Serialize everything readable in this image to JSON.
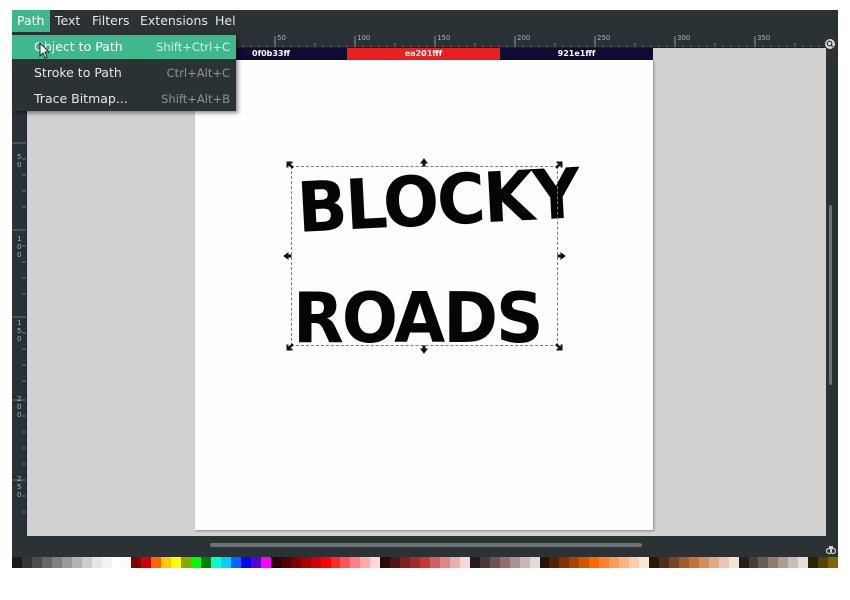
{
  "menubar": {
    "items": [
      {
        "label": "Path"
      },
      {
        "label": "Text"
      },
      {
        "label": "Filters"
      },
      {
        "label": "Extensions"
      },
      {
        "label": "Help"
      }
    ]
  },
  "path_menu": {
    "items": [
      {
        "label": "Object to Path",
        "shortcut": "Shift+Ctrl+C"
      },
      {
        "label": "Stroke to Path",
        "shortcut": "Ctrl+Alt+C"
      },
      {
        "label": "Trace Bitmap...",
        "shortcut": "Shift+Alt+B"
      }
    ]
  },
  "ruler": {
    "h_labels": [
      "50",
      "100",
      "150",
      "200",
      "250",
      "300",
      "350"
    ],
    "v_labels": [
      "5\n0",
      "1\n0\n0",
      "1\n5\n0",
      "2\n0\n0",
      "2\n5\n0"
    ]
  },
  "swatch_bar": [
    {
      "label": "0f0b33ff",
      "color": "#0f0b33"
    },
    {
      "label": "ea201fff",
      "color": "#ea201f"
    },
    {
      "label": "921e1fff",
      "color": "#0f0b33"
    }
  ],
  "artwork": {
    "line1": "BLOCKY",
    "line2": "ROADS"
  },
  "colors": {
    "accent": "#3fb98b",
    "chrome": "#2b3236",
    "canvas": "#d1d1d0"
  }
}
